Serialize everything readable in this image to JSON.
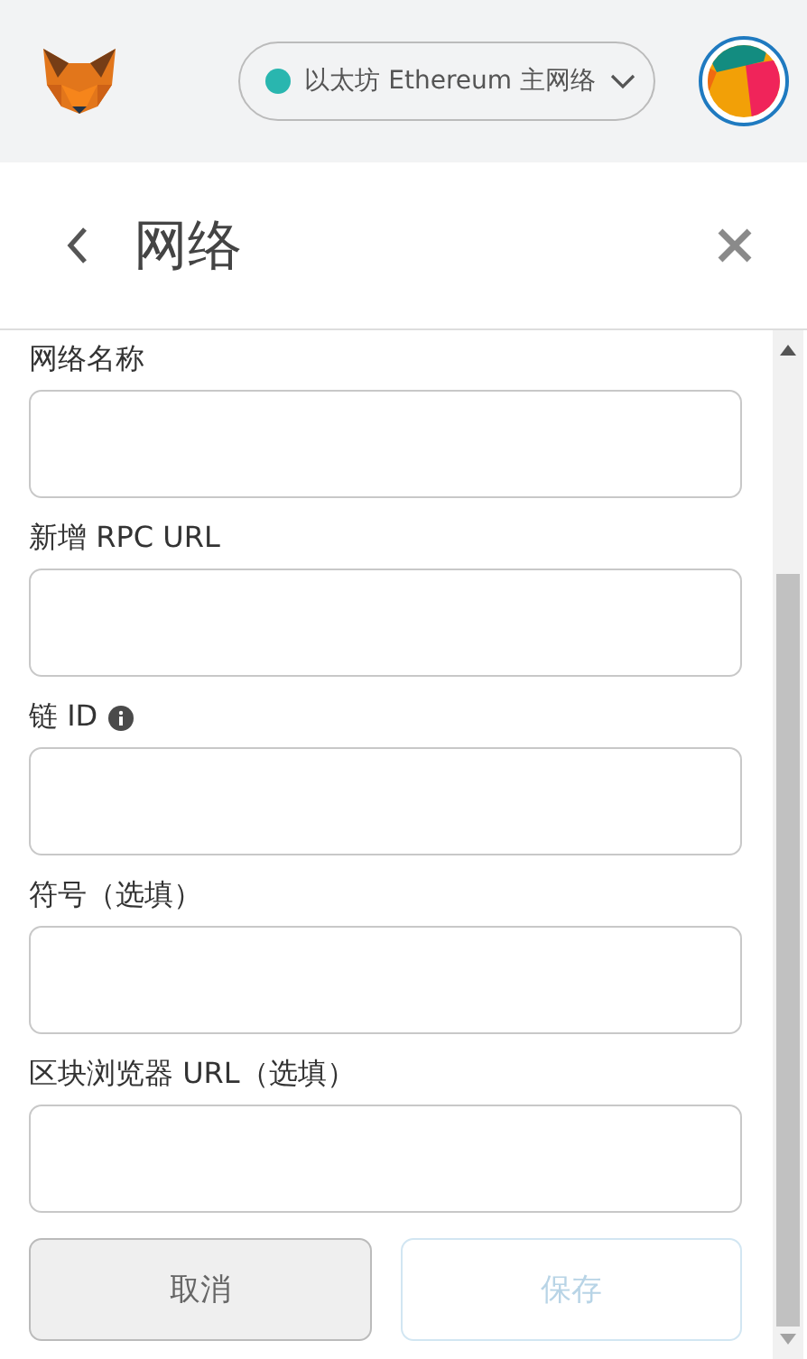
{
  "network": {
    "label": "以太坊 Ethereum 主网络",
    "color": "#29b6af"
  },
  "page": {
    "title": "网络"
  },
  "fields": [
    {
      "label": "网络名称",
      "info": false
    },
    {
      "label": "新增 RPC URL",
      "info": false
    },
    {
      "label": "链 ID",
      "info": true
    },
    {
      "label": "符号（选填）",
      "info": false
    },
    {
      "label": "区块浏览器 URL（选填）",
      "info": false
    }
  ],
  "buttons": [
    {
      "label": "取消",
      "kind": "cancel",
      "disabled": false
    },
    {
      "label": "保存",
      "kind": "save",
      "disabled": true
    }
  ]
}
